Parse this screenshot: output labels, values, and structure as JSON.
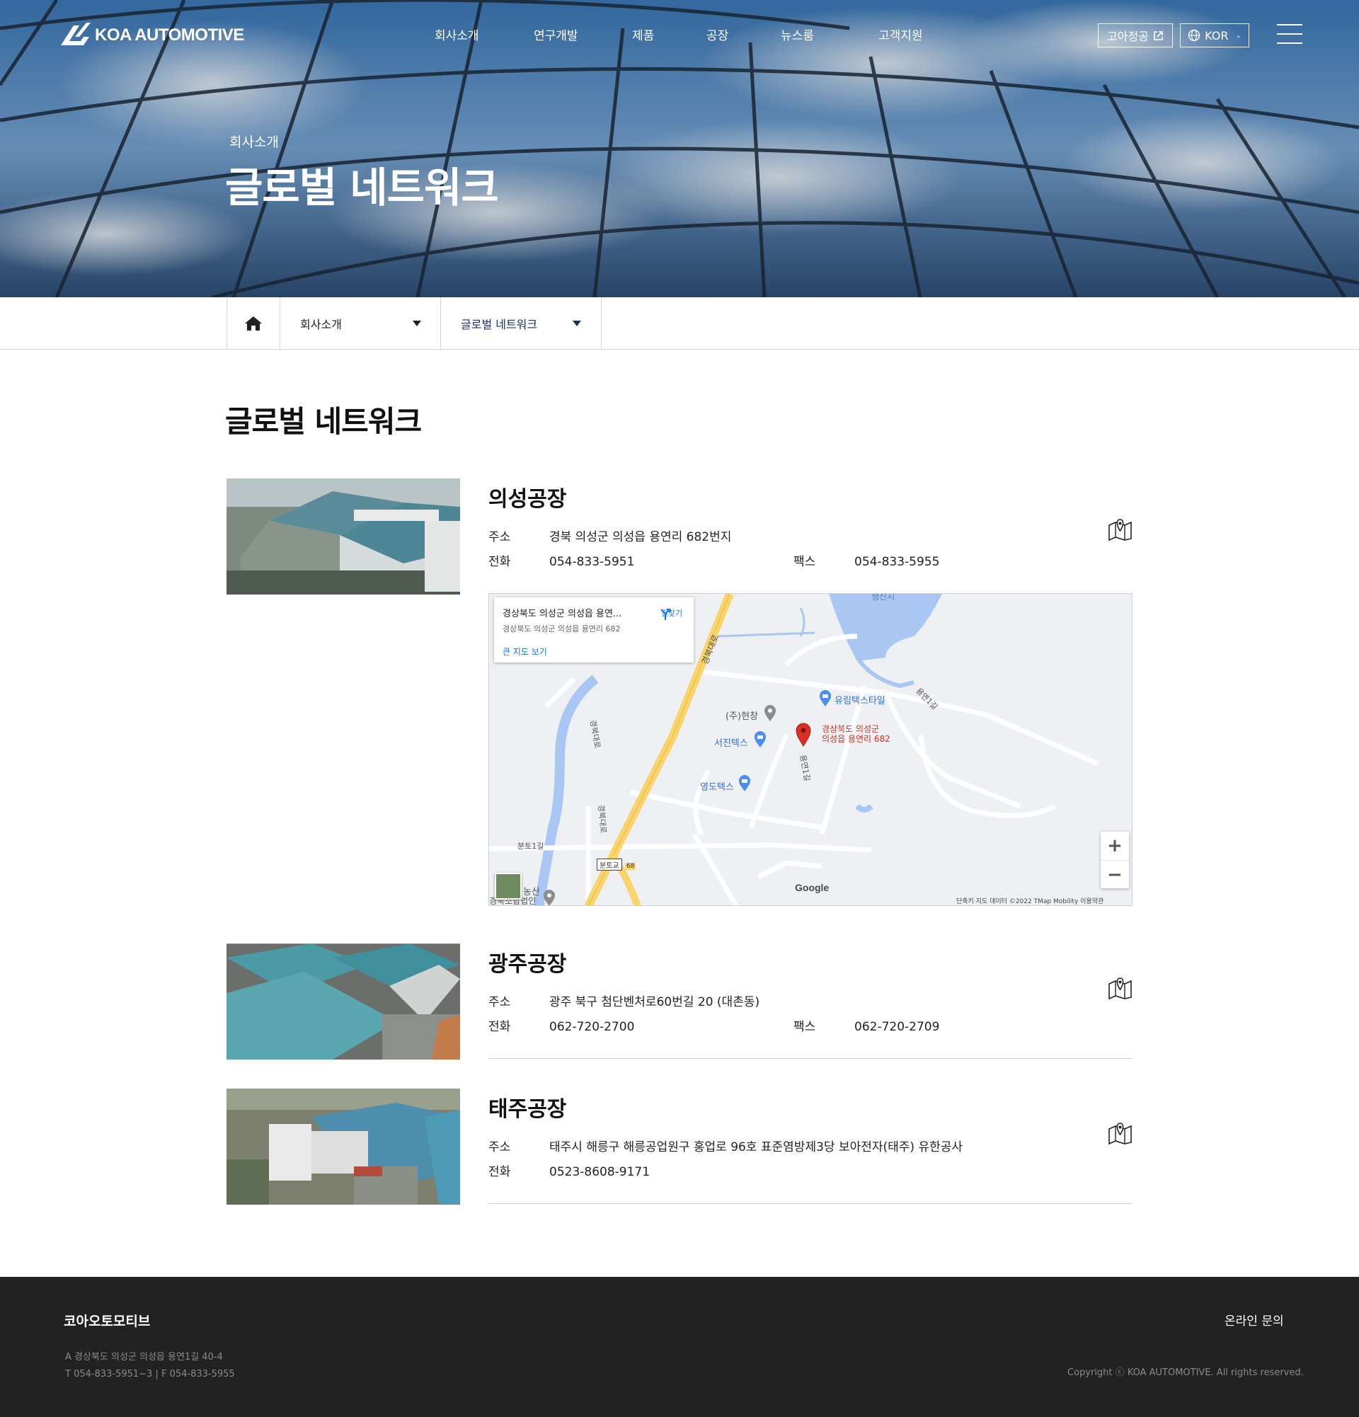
{
  "header": {
    "logo_text": "KOA AUTOMOTIVE",
    "nav": [
      "회사소개",
      "연구개발",
      "제품",
      "공장",
      "뉴스룸",
      "고객지원"
    ],
    "koa_link": "고아정공",
    "language": "KOR"
  },
  "hero": {
    "category": "회사소개",
    "title": "글로벌 네트워크"
  },
  "breadcrumb": {
    "level1": "회사소개",
    "level2": "글로벌 네트워크"
  },
  "content": {
    "title": "글로벌 네트워크",
    "address_label": "주소",
    "phone_label": "전화",
    "fax_label": "팩스",
    "plants": [
      {
        "name": "의성공장",
        "address": "경북 의성군 의성읍 용연리 682번지",
        "phone": "054-833-5951",
        "fax": "054-833-5955"
      },
      {
        "name": "광주공장",
        "address": "광주 북구 첨단벤처로60번길 20 (대촌동)",
        "phone": "062-720-2700",
        "fax": "062-720-2709"
      },
      {
        "name": "태주공장",
        "address": "태주시 해릉구 해릉공업원구 홍업로 96호 표준염방제3당 보아전자(태주) 유한공사",
        "phone": "0523-8608-9171"
      }
    ]
  },
  "map": {
    "card_title": "경상북도 의성군 의성읍 용연...",
    "card_subtitle": "경상북도 의성군 의성읍 용연리 682",
    "card_link": "큰 지도 보기",
    "directions": "길찾기",
    "labels": {
      "top_place": "생신지",
      "road_main": "경북대로",
      "road_west": "경북대로",
      "road_west2": "경북대로",
      "hyunchang": "(주)현창",
      "seojin": "서진텍스",
      "yurim": "유림텍스타일",
      "yeongdo": "영도텍스",
      "marker_line1": "경상북도 의성군",
      "marker_line2": "의성읍 용연리 682",
      "yongyeon1": "용연1길",
      "yongyeon1b": "용연1길",
      "buntoe": "분토1길",
      "buntoe_bridge": "분토교",
      "route": "68",
      "nongsan": "농산",
      "corp": "경북소합법인"
    },
    "zoom_in": "+",
    "zoom_out": "−",
    "google": "Google",
    "attribution": "단축키   지도 데이터 ©2022 TMap Mobility   이용약관"
  },
  "footer": {
    "brand": "코아오토모티브",
    "inquiry": "온라인 문의",
    "address": "A   경상북도 의성군 의성읍 용연1길 40-4",
    "contact": "T   054-833-5951~3   |   F   054-833-5955",
    "copyright": "Copyright ⓒ KOA AUTOMOTIVE. All rights reserved."
  },
  "colors": {
    "accent_navy": "#1a2f6b",
    "footer_bg": "#222222",
    "map_road": "#f9d46b",
    "map_water": "#aac7f4",
    "marker": "#d93025"
  }
}
